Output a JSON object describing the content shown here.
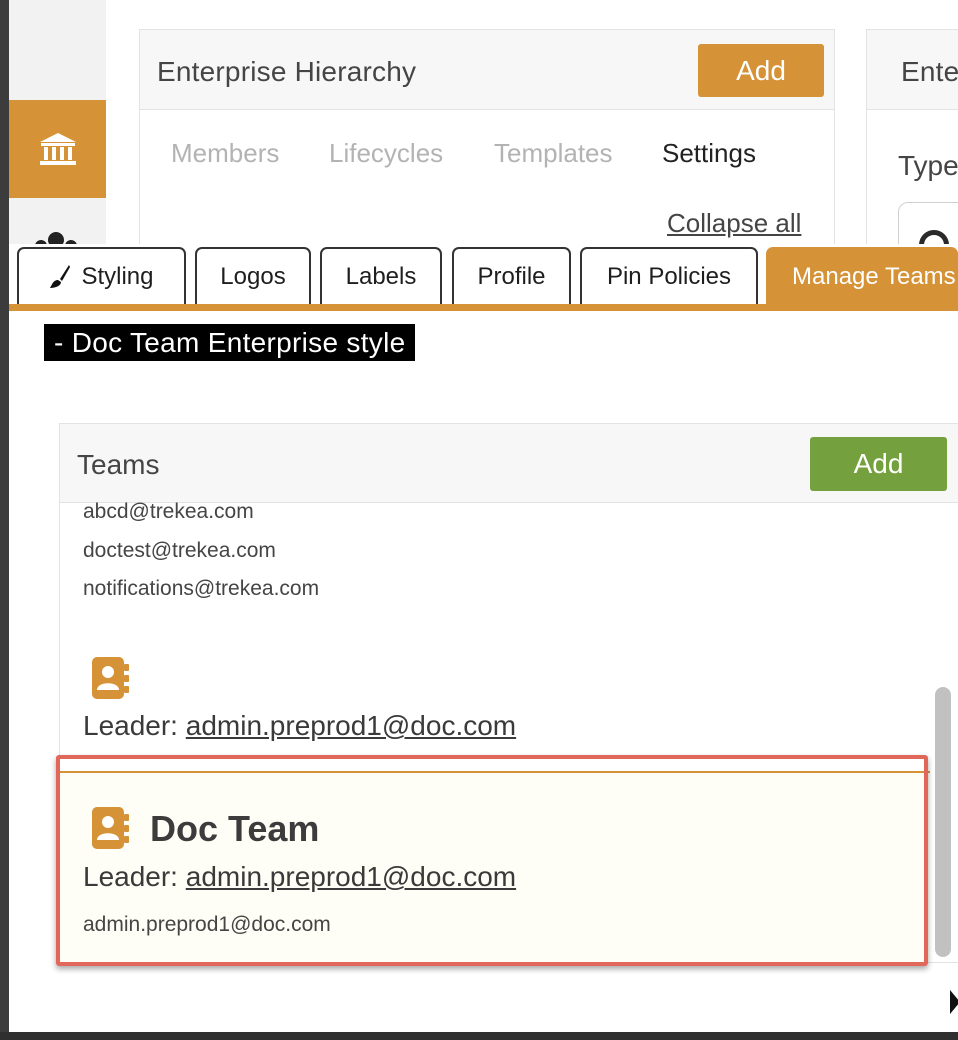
{
  "background_panel": {
    "title": "Enterprise Hierarchy",
    "add_label": "Add",
    "sub_tabs": [
      "Members",
      "Lifecycles",
      "Templates",
      "Settings"
    ],
    "active_sub_tab": "Settings",
    "collapse_label": "Collapse all"
  },
  "side_panel": {
    "title": "Ente",
    "type_label": "Type"
  },
  "tabs": {
    "styling": "Styling",
    "logos": "Logos",
    "labels": "Labels",
    "profile": "Profile",
    "pin_policies": "Pin Policies",
    "manage_teams": "Manage Teams"
  },
  "style_heading": "- Doc Team Enterprise style",
  "teams": {
    "title": "Teams",
    "add_label": "Add",
    "members": [
      "abcd@trekea.com",
      "doctest@trekea.com",
      "notifications@trekea.com"
    ],
    "team_1": {
      "leader_prefix": "Leader:",
      "leader_email": "admin.preprod1@doc.com"
    },
    "doc_team": {
      "name": "Doc Team",
      "leader_prefix": "Leader:",
      "leader_email": "admin.preprod1@doc.com",
      "member": "admin.preprod1@doc.com"
    }
  },
  "colors": {
    "accent_orange": "#d59236",
    "add_green": "#74a03e",
    "highlight_red": "#e0675a"
  }
}
